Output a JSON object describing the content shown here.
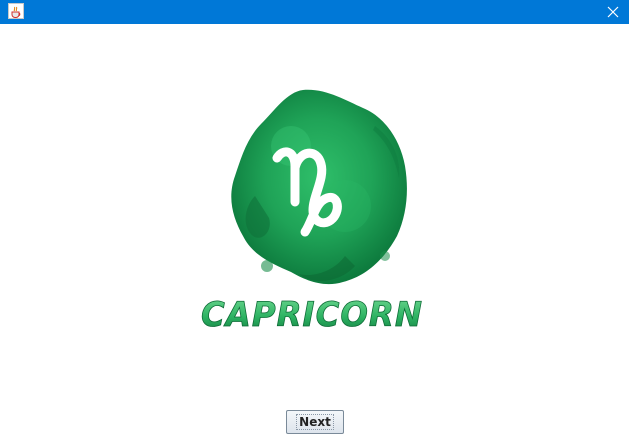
{
  "window": {
    "icon": "java-cup-icon",
    "close_icon": "close-icon"
  },
  "main": {
    "logo_text": "CAPRICORN",
    "logo_symbol": "♑",
    "logo_color": "#1f9a55"
  },
  "footer": {
    "next_label": "Next"
  }
}
